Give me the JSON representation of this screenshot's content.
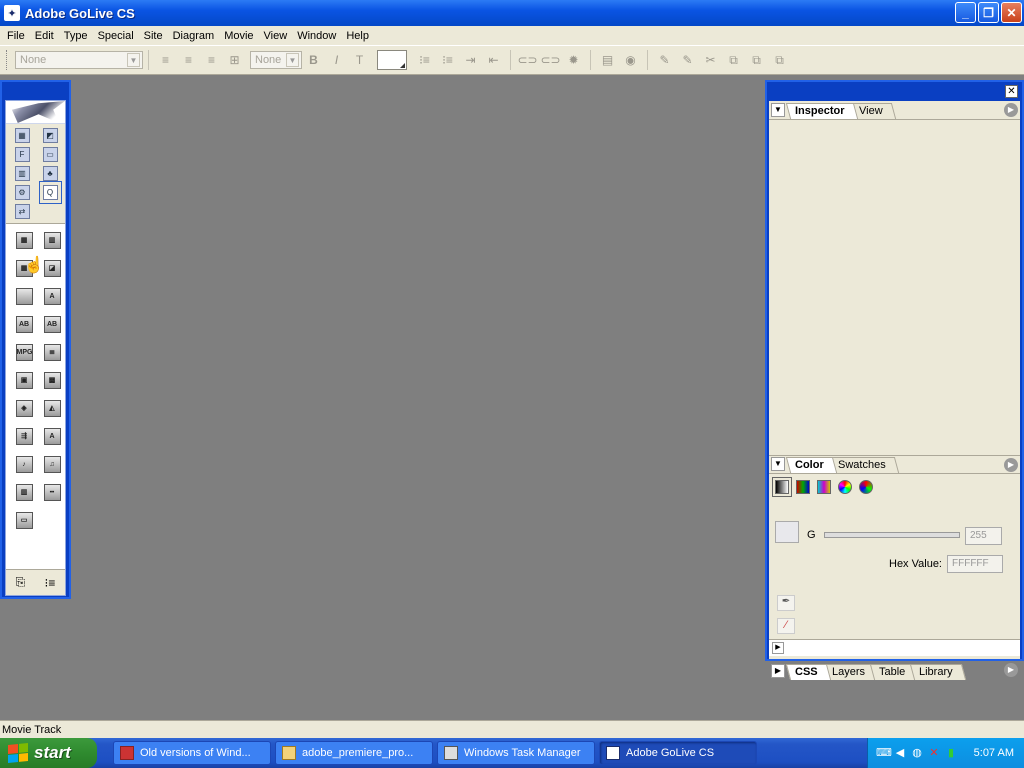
{
  "window": {
    "title": "Adobe GoLive CS"
  },
  "menu": [
    "File",
    "Edit",
    "Type",
    "Special",
    "Site",
    "Diagram",
    "Movie",
    "View",
    "Window",
    "Help"
  ],
  "toolbar": {
    "paragraph_select": "None",
    "font_size_select": "None"
  },
  "objects_palette": {
    "tabs": [
      "basic",
      "smart",
      "forms",
      "head",
      "frames",
      "site",
      "diagram",
      "quicktime",
      "smil"
    ],
    "items": [
      "movie-track",
      "filmstrip",
      "grid",
      "image",
      "gradient",
      "text",
      "ab",
      "ab2",
      "mpg",
      "list",
      "box",
      "pattern",
      "3d",
      "picture",
      "transition",
      "font",
      "sound",
      "music",
      "clip",
      "line",
      "frame"
    ]
  },
  "inspector": {
    "tabs": [
      "Inspector",
      "View"
    ]
  },
  "color_panel": {
    "tabs": [
      "Color",
      "Swatches"
    ],
    "channel_label": "G",
    "channel_value": "255",
    "hex_label": "Hex Value:",
    "hex_value": "FFFFFF"
  },
  "bottom_tabs": [
    "CSS",
    "Layers",
    "Table",
    "Library"
  ],
  "statusbar": {
    "text": "Movie Track"
  },
  "taskbar": {
    "start_label": "start",
    "tasks": [
      "Old versions of Wind...",
      "adobe_premiere_pro...",
      "Windows Task Manager",
      "Adobe GoLive CS"
    ],
    "clock": "5:07 AM"
  }
}
